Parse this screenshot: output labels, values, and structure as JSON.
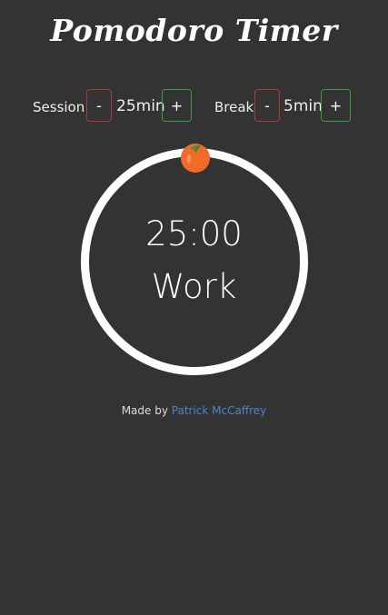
{
  "app": {
    "title": "Pomodoro Timer"
  },
  "session": {
    "label": "Session",
    "minus_label": "-",
    "value": "25min",
    "plus_label": "+"
  },
  "break": {
    "label": "Break",
    "minus_label": "-",
    "value": "5min",
    "plus_label": "+"
  },
  "timer": {
    "time": "25:00",
    "mode": "Work",
    "progress": 0
  },
  "icons": {
    "indicator": "tomato-icon"
  },
  "footer": {
    "prefix": "Made by",
    "author": "Patrick McCaffrey"
  },
  "colors": {
    "background": "#333333",
    "ring": "#ffffff",
    "minus_border": "#b03a3a",
    "plus_border": "#3d9a46",
    "link": "#4a86c8",
    "tomato": "#f06a2a"
  }
}
